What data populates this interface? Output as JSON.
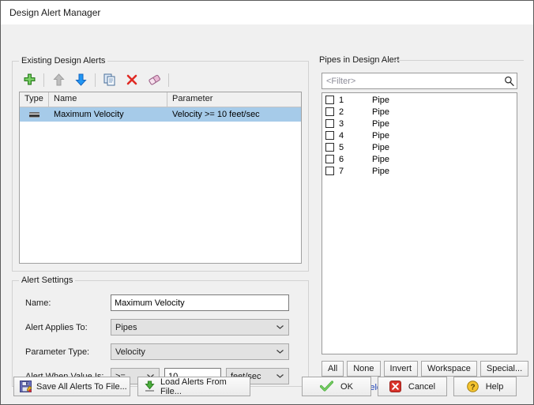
{
  "window": {
    "title": "Design Alert Manager"
  },
  "existing": {
    "legend": "Existing Design Alerts",
    "toolbar": [
      {
        "name": "add-alert-button",
        "icon": "plus-icon",
        "enabled": true
      },
      {
        "name": "move-up-button",
        "icon": "arrow-up-icon",
        "enabled": false
      },
      {
        "name": "move-down-button",
        "icon": "arrow-down-icon",
        "enabled": true
      },
      {
        "name": "duplicate-button",
        "icon": "copy-icon",
        "enabled": true
      },
      {
        "name": "delete-button",
        "icon": "red-x-icon",
        "enabled": true
      },
      {
        "name": "clear-button",
        "icon": "eraser-icon",
        "enabled": true
      }
    ],
    "columns": [
      "Type",
      "Name",
      "Parameter"
    ],
    "rows": [
      {
        "type_icon": "equals-bar-icon",
        "name": "Maximum Velocity",
        "parameter": "Velocity >= 10 feet/sec",
        "selected": true
      }
    ]
  },
  "settings": {
    "legend": "Alert Settings",
    "name_label": "Name:",
    "name_value": "Maximum Velocity",
    "applies_label": "Alert Applies To:",
    "applies_value": "Pipes",
    "param_label": "Parameter Type:",
    "param_value": "Velocity",
    "when_label": "Alert When Value Is:",
    "operator_value": ">=",
    "threshold_value": "10",
    "units_value": "feet/sec"
  },
  "pipes": {
    "legend": "Pipes in Design Alert",
    "filter_placeholder": "<Filter>",
    "filter_icon": "search-icon",
    "items": [
      {
        "number": "1",
        "name": "Pipe",
        "checked": false
      },
      {
        "number": "2",
        "name": "Pipe",
        "checked": false
      },
      {
        "number": "3",
        "name": "Pipe",
        "checked": false
      },
      {
        "number": "4",
        "name": "Pipe",
        "checked": false
      },
      {
        "number": "5",
        "name": "Pipe",
        "checked": false
      },
      {
        "number": "6",
        "name": "Pipe",
        "checked": false
      },
      {
        "number": "7",
        "name": "Pipe",
        "checked": false
      }
    ],
    "select_buttons": [
      "All",
      "None",
      "Invert",
      "Workspace",
      "Special..."
    ],
    "selected_status": "Selected: 0 of 7",
    "selected_status_color": "#1a3fb5"
  },
  "bottom": {
    "save_label": "Save All Alerts To File...",
    "save_icon": "save-disk-icon",
    "load_label": "Load Alerts From File...",
    "load_icon": "green-down-arrow-icon",
    "ok_label": "OK",
    "ok_icon": "green-check-icon",
    "cancel_label": "Cancel",
    "cancel_icon": "red-x-box-icon",
    "help_label": "Help",
    "help_icon": "yellow-question-icon"
  }
}
